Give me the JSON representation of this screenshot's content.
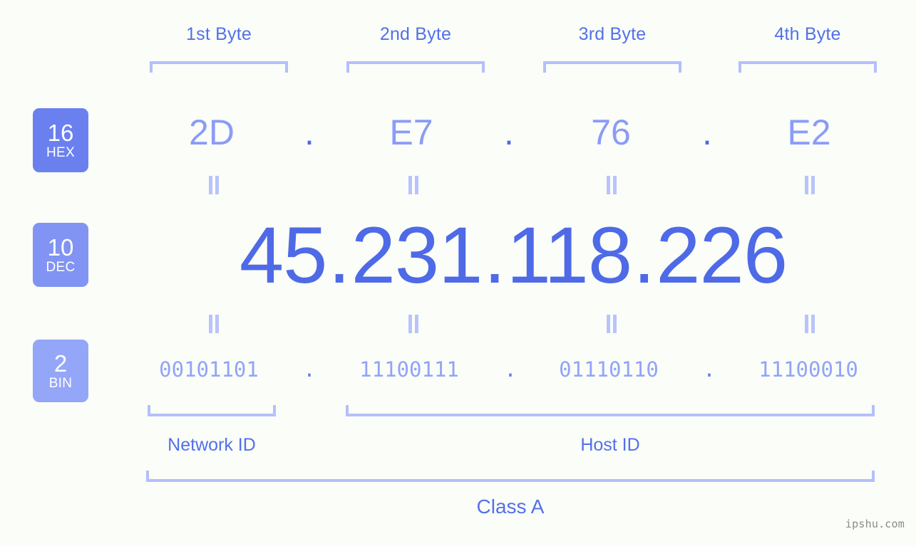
{
  "meta": {
    "background_color": "#fbfdf9",
    "accent_primary": "#4f6ae6",
    "accent_light": "#92a4f7",
    "bracket_color": "#b4bffb"
  },
  "byte_headers": [
    {
      "label": "1st Byte"
    },
    {
      "label": "2nd Byte"
    },
    {
      "label": "3rd Byte"
    },
    {
      "label": "4th Byte"
    }
  ],
  "bases": [
    {
      "number": "16",
      "name": "HEX",
      "color": "#6b80ef"
    },
    {
      "number": "10",
      "name": "DEC",
      "color": "#8194f3"
    },
    {
      "number": "2",
      "name": "BIN",
      "color": "#94a6f8"
    }
  ],
  "separator": ".",
  "rows": {
    "hex": {
      "octets": [
        "2D",
        "E7",
        "76",
        "E2"
      ],
      "joined": "2D.E7.76.E2"
    },
    "dec": {
      "octets": [
        "45",
        "231",
        "118",
        "226"
      ],
      "joined": "45.231.118.226"
    },
    "bin": {
      "octets": [
        "00101101",
        "11100111",
        "01110110",
        "11100010"
      ],
      "joined": "00101101.11100111.01110110.11100010"
    }
  },
  "equals_symbol": "=",
  "sections": {
    "network_id": "Network ID",
    "host_id": "Host ID",
    "class": "Class A"
  },
  "watermark": "ipshu.com"
}
